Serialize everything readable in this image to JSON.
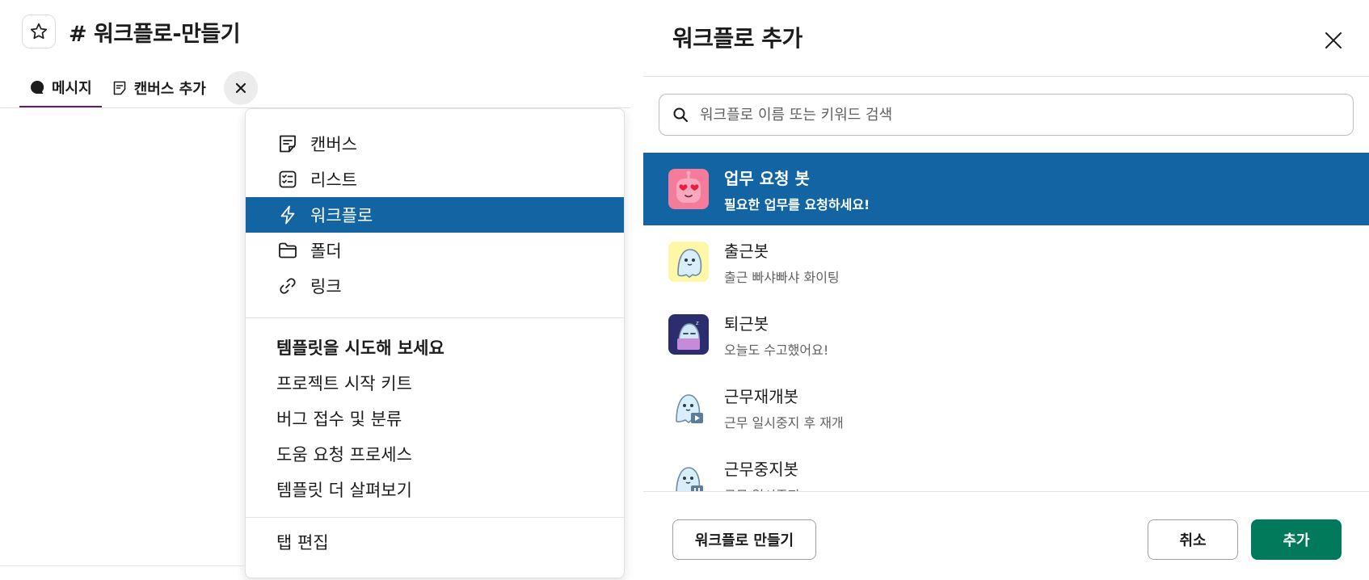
{
  "channel": {
    "title": "# 워크플로-만들기",
    "tabs": [
      {
        "label": "메시지",
        "icon": "message-bubble-icon",
        "active": true
      },
      {
        "label": "캔버스 추가",
        "icon": "canvas-icon",
        "active": false
      }
    ]
  },
  "dropdown": {
    "items": [
      {
        "label": "캔버스",
        "icon": "canvas-icon"
      },
      {
        "label": "리스트",
        "icon": "list-icon"
      },
      {
        "label": "워크플로",
        "icon": "lightning-icon",
        "selected": true
      },
      {
        "label": "폴더",
        "icon": "folder-icon"
      },
      {
        "label": "링크",
        "icon": "link-icon"
      }
    ],
    "templates_heading": "템플릿을 시도해 보세요",
    "templates": [
      "프로젝트 시작 키트",
      "버그 접수 및 분류",
      "도움 요청 프로세스",
      "템플릿 더 살펴보기"
    ],
    "edit_tabs": "탭 편집"
  },
  "modal": {
    "title": "워크플로 추가",
    "search_placeholder": "워크플로 이름 또는 키워드 검색",
    "workflows": [
      {
        "name": "업무 요청 봇",
        "desc": "필요한 업무를 요청하세요!",
        "selected": true
      },
      {
        "name": "출근봇",
        "desc": "출근 빠샤빠샤 화이팅"
      },
      {
        "name": "퇴근봇",
        "desc": "오늘도 수고했어요!"
      },
      {
        "name": "근무재개봇",
        "desc": "근무 일시중지 후 재개"
      },
      {
        "name": "근무중지봇",
        "desc": "근무 일시중지"
      }
    ],
    "create_button": "워크플로 만들기",
    "cancel_button": "취소",
    "add_button": "추가"
  },
  "colors": {
    "selection": "#1264a3",
    "primary_button": "#007a5a",
    "active_tab_underline": "#611f69"
  }
}
